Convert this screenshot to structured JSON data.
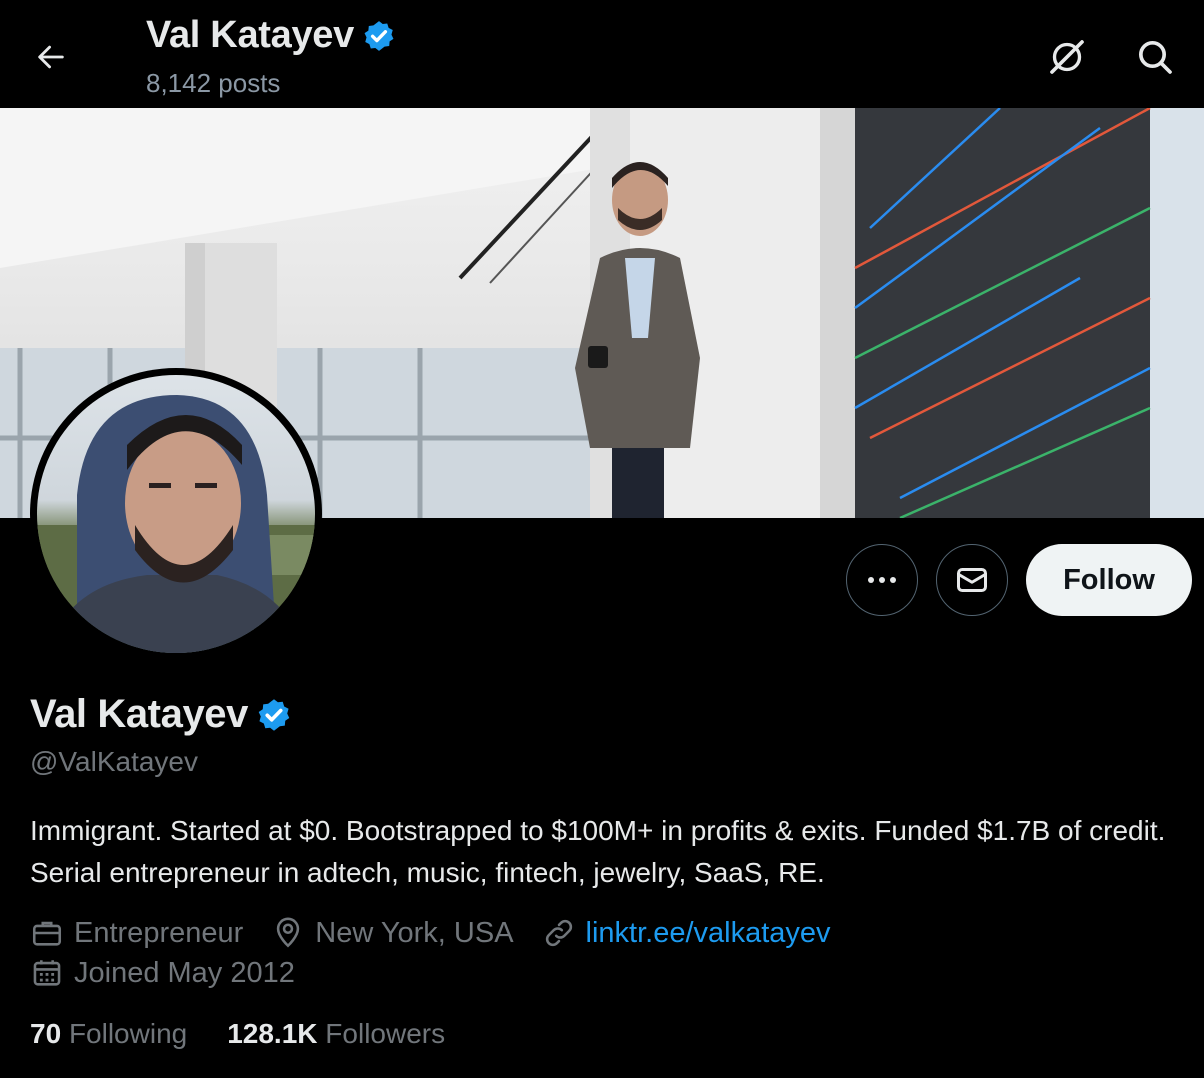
{
  "header": {
    "name": "Val Katayev",
    "posts_count": "8,142 posts"
  },
  "profile": {
    "name": "Val Katayev",
    "handle": "@ValKatayev",
    "bio": "Immigrant. Started at $0. Bootstrapped to $100M+ in profits & exits. Funded $1.7B of credit. Serial entrepreneur in adtech, music, fintech, jewelry, SaaS, RE.",
    "profession": "Entrepreneur",
    "location": "New York, USA",
    "link": "linktr.ee/valkatayev",
    "joined": "Joined May 2012",
    "following_count": "70",
    "following_label": "Following",
    "followers_count": "128.1K",
    "followers_label": "Followers"
  },
  "actions": {
    "follow_label": "Follow"
  },
  "colors": {
    "accent": "#1d9bf0",
    "background": "#000000",
    "secondary_text": "#71767b"
  },
  "icons": [
    "back-arrow-icon",
    "grok-icon",
    "search-icon",
    "more-icon",
    "message-icon",
    "verified-icon",
    "briefcase-icon",
    "location-icon",
    "link-icon",
    "calendar-icon"
  ]
}
